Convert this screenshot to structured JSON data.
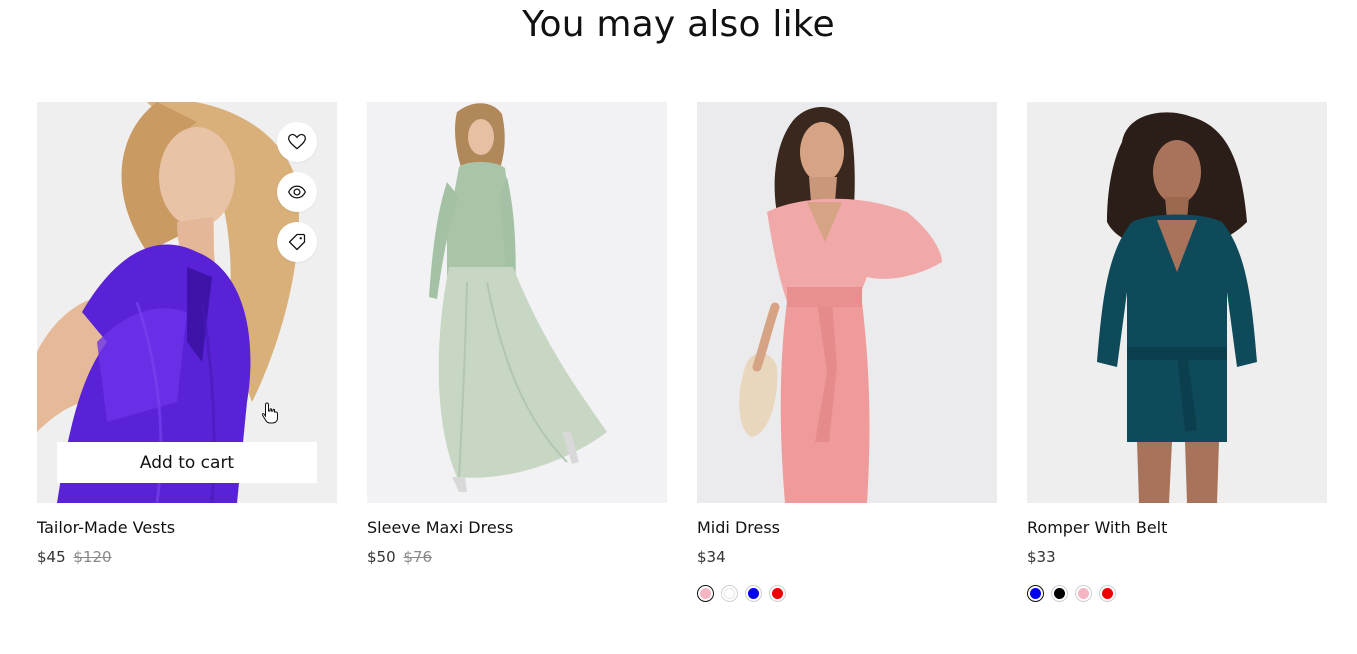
{
  "section": {
    "title": "You may also like"
  },
  "products": [
    {
      "name": "Tailor-Made Vests",
      "price": "$45",
      "old_price": "$120",
      "add_to_cart_label": "Add to cart",
      "image": "woman in purple velvet sleeveless vest",
      "actions": [
        "heart-icon",
        "eye-icon",
        "tag-icon"
      ]
    },
    {
      "name": "Sleeve Maxi Dress",
      "price": "$50",
      "old_price": "$76",
      "image": "woman in sage green sequin tulle maxi dress"
    },
    {
      "name": "Midi Dress",
      "price": "$34",
      "image": "woman in pink kimono sleeve belted midi dress",
      "swatches": [
        "#f4b6c2",
        "#ffffff",
        "#0000ee",
        "#ee0000"
      ]
    },
    {
      "name": "Romper With Belt",
      "price": "$33",
      "image": "woman in teal belted wrap romper",
      "swatches": [
        "#0000ee",
        "#000000",
        "#f4b6c2",
        "#ee0000"
      ]
    }
  ]
}
